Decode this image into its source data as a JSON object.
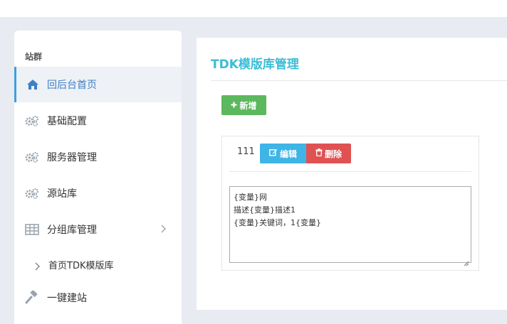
{
  "sidebar": {
    "section_title": "站群",
    "items": [
      {
        "label": "回后台首页",
        "icon": "home-icon",
        "active": true
      },
      {
        "label": "基础配置",
        "icon": "gears-icon"
      },
      {
        "label": "服务器管理",
        "icon": "gears-icon"
      },
      {
        "label": "源站库",
        "icon": "gears-icon"
      },
      {
        "label": "分组库管理",
        "icon": "table-icon",
        "expandable": true
      },
      {
        "label": "首页TDK模版库",
        "icon": "chevron-right-icon",
        "sub": true
      },
      {
        "label": "一键建站",
        "icon": "gavel-icon"
      }
    ]
  },
  "main": {
    "title": "TDK模版库管理",
    "add_button": "新增",
    "card": {
      "id": "111",
      "edit_button": "编辑",
      "delete_button": "删除",
      "content": "{变量}网\n描述{变量}描述1\n{变量}关键词，1{变量}"
    }
  },
  "colors": {
    "accent": "#3bbdd6",
    "active_nav": "#3f7fc4",
    "add": "#5cb85c",
    "edit": "#3fb4e6",
    "delete": "#e05252",
    "background": "#e8ebf2"
  }
}
